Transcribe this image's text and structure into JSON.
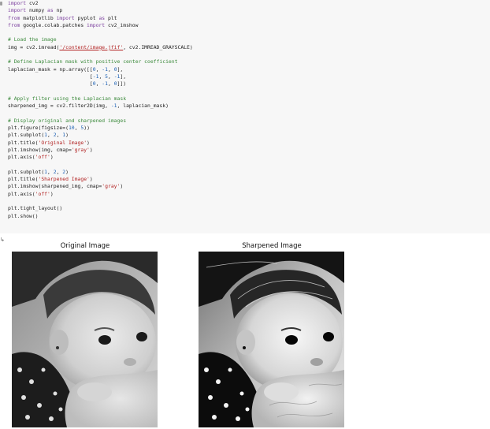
{
  "code": {
    "lines": [
      {
        "segs": [
          {
            "t": "import",
            "c": "kw"
          },
          {
            "t": " cv2"
          }
        ]
      },
      {
        "segs": [
          {
            "t": "import",
            "c": "kw"
          },
          {
            "t": " numpy "
          },
          {
            "t": "as",
            "c": "kw"
          },
          {
            "t": " np"
          }
        ]
      },
      {
        "segs": [
          {
            "t": "from",
            "c": "kw"
          },
          {
            "t": " matplotlib "
          },
          {
            "t": "import",
            "c": "kw"
          },
          {
            "t": " pyplot "
          },
          {
            "t": "as",
            "c": "kw"
          },
          {
            "t": " plt"
          }
        ]
      },
      {
        "segs": [
          {
            "t": "from",
            "c": "kw"
          },
          {
            "t": " google.colab.patches "
          },
          {
            "t": "import",
            "c": "kw"
          },
          {
            "t": " cv2_imshow"
          }
        ]
      },
      {
        "segs": []
      },
      {
        "segs": [
          {
            "t": "# Load the image",
            "c": "cm"
          }
        ]
      },
      {
        "segs": [
          {
            "t": "img = cv2.imread("
          },
          {
            "t": "'/content/image.jfif'",
            "c": "st u"
          },
          {
            "t": ", cv2.IMREAD_GRAYSCALE)"
          }
        ]
      },
      {
        "segs": []
      },
      {
        "segs": [
          {
            "t": "# Define Laplacian mask with positive center coefficient",
            "c": "cm"
          }
        ]
      },
      {
        "segs": [
          {
            "t": "laplacian_mask = np.array([["
          },
          {
            "t": "0",
            "c": "nm"
          },
          {
            "t": ", "
          },
          {
            "t": "-1",
            "c": "nm"
          },
          {
            "t": ", "
          },
          {
            "t": "0",
            "c": "nm"
          },
          {
            "t": "],"
          }
        ]
      },
      {
        "segs": [
          {
            "t": "                           ["
          },
          {
            "t": "-1",
            "c": "nm"
          },
          {
            "t": ", "
          },
          {
            "t": "5",
            "c": "nm"
          },
          {
            "t": ", "
          },
          {
            "t": "-1",
            "c": "nm"
          },
          {
            "t": "],"
          }
        ]
      },
      {
        "segs": [
          {
            "t": "                           ["
          },
          {
            "t": "0",
            "c": "nm"
          },
          {
            "t": ", "
          },
          {
            "t": "-1",
            "c": "nm"
          },
          {
            "t": ", "
          },
          {
            "t": "0",
            "c": "nm"
          },
          {
            "t": "]])"
          }
        ]
      },
      {
        "segs": []
      },
      {
        "segs": [
          {
            "t": "# Apply filter using the Laplacian mask",
            "c": "cm"
          }
        ]
      },
      {
        "segs": [
          {
            "t": "sharpened_img = cv2.filter2D(img, "
          },
          {
            "t": "-1",
            "c": "nm"
          },
          {
            "t": ", laplacian_mask)"
          }
        ]
      },
      {
        "segs": []
      },
      {
        "segs": [
          {
            "t": "# Display original and sharpened images",
            "c": "cm"
          }
        ]
      },
      {
        "segs": [
          {
            "t": "plt.figure(figsize=("
          },
          {
            "t": "10",
            "c": "nm"
          },
          {
            "t": ", "
          },
          {
            "t": "5",
            "c": "nm"
          },
          {
            "t": "))"
          }
        ]
      },
      {
        "segs": [
          {
            "t": "plt.subplot("
          },
          {
            "t": "1",
            "c": "nm"
          },
          {
            "t": ", "
          },
          {
            "t": "2",
            "c": "nm"
          },
          {
            "t": ", "
          },
          {
            "t": "1",
            "c": "nm"
          },
          {
            "t": ")"
          }
        ]
      },
      {
        "segs": [
          {
            "t": "plt.title("
          },
          {
            "t": "'Original Image'",
            "c": "st"
          },
          {
            "t": ")"
          }
        ]
      },
      {
        "segs": [
          {
            "t": "plt.imshow(img, cmap="
          },
          {
            "t": "'gray'",
            "c": "st"
          },
          {
            "t": ")"
          }
        ]
      },
      {
        "segs": [
          {
            "t": "plt.axis("
          },
          {
            "t": "'off'",
            "c": "st"
          },
          {
            "t": ")"
          }
        ]
      },
      {
        "segs": []
      },
      {
        "segs": [
          {
            "t": "plt.subplot("
          },
          {
            "t": "1",
            "c": "nm"
          },
          {
            "t": ", "
          },
          {
            "t": "2",
            "c": "nm"
          },
          {
            "t": ", "
          },
          {
            "t": "2",
            "c": "nm"
          },
          {
            "t": ")"
          }
        ]
      },
      {
        "segs": [
          {
            "t": "plt.title("
          },
          {
            "t": "'Sharpened Image'",
            "c": "st"
          },
          {
            "t": ")"
          }
        ]
      },
      {
        "segs": [
          {
            "t": "plt.imshow(sharpened_img, cmap="
          },
          {
            "t": "'gray'",
            "c": "st"
          },
          {
            "t": ")"
          }
        ]
      },
      {
        "segs": [
          {
            "t": "plt.axis("
          },
          {
            "t": "'off'",
            "c": "st"
          },
          {
            "t": ")"
          }
        ]
      },
      {
        "segs": []
      },
      {
        "segs": [
          {
            "t": "plt.tight_layout()"
          }
        ]
      },
      {
        "segs": [
          {
            "t": "plt.show()"
          }
        ]
      }
    ]
  },
  "output": {
    "marker": "↳",
    "left_title": "Original Image",
    "right_title": "Sharpened Image"
  },
  "colors": {
    "keyword": "#7a3e9d",
    "comment": "#3d8b3d",
    "string": "#b22222",
    "number": "#1a5fb4",
    "cell_background": "#f7f7f7"
  }
}
